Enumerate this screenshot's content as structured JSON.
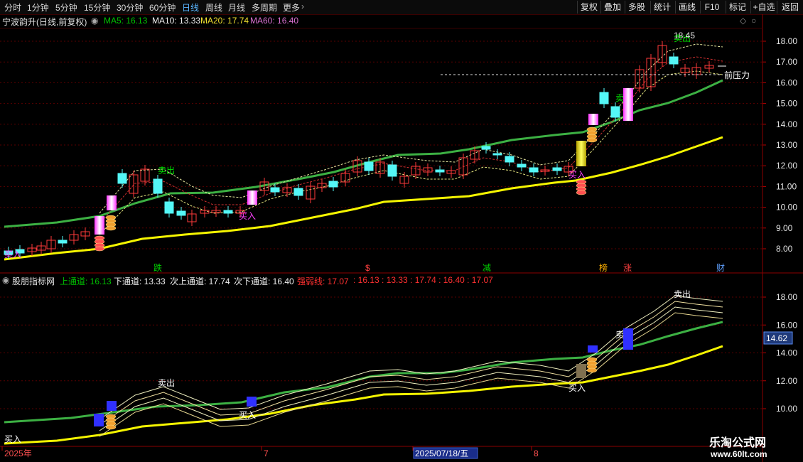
{
  "toolbar": {
    "periods": [
      "分时",
      "1分钟",
      "5分钟",
      "15分钟",
      "30分钟",
      "60分钟",
      "日线",
      "周线",
      "月线",
      "多周期",
      "更多"
    ],
    "active_period": "日线",
    "right_buttons": [
      "复权",
      "叠加",
      "多股",
      "统计",
      "画线",
      "F10",
      "标记",
      "+自选",
      "返回"
    ]
  },
  "main_panel": {
    "title": "宁波韵升(日线,前复权)",
    "ma": [
      {
        "label": "MA5: 16.13",
        "color": "#00c000"
      },
      {
        "label": "MA10: 13.33",
        "color": "#f0f0f0"
      },
      {
        "label": "MA20: 17.74",
        "color": "#f0e030"
      },
      {
        "label": "MA60: 16.40",
        "color": "#d870d0"
      }
    ],
    "y_ticks": [
      "18.00",
      "17.00",
      "16.00",
      "15.00",
      "14.00",
      "13.00",
      "12.00",
      "11.00",
      "10.00",
      "9.00",
      "8.00"
    ],
    "annotations": [
      {
        "id": "sell1",
        "text": "卖出"
      },
      {
        "id": "sell2",
        "text": "卖出"
      },
      {
        "id": "buy1",
        "text": "买入"
      },
      {
        "id": "buy2",
        "text": "买入"
      },
      {
        "id": "buy3",
        "text": "买入"
      },
      {
        "id": "peak",
        "text": "18.45"
      },
      {
        "id": "resist",
        "text": "前压力"
      },
      {
        "id": "m1",
        "text": "卖"
      }
    ],
    "event_marks": [
      {
        "text": "跌",
        "color": "#00d000"
      },
      {
        "text": "$",
        "color": "#ff4040"
      },
      {
        "text": "减",
        "color": "#00d000"
      },
      {
        "text": "榜",
        "color": "#ffb000"
      },
      {
        "text": "涨",
        "color": "#ff4040"
      },
      {
        "text": "财",
        "color": "#60a0ff"
      }
    ]
  },
  "sub_panel": {
    "title": "股朋指标网",
    "lines": [
      {
        "label": "上通道: 16.13",
        "color": "#00c000"
      },
      {
        "label": "下通道: 13.33",
        "color": "#f0f0f0"
      },
      {
        "label": "次上通道: 17.74",
        "color": "#f0f0f0"
      },
      {
        "label": "次下通道: 16.40",
        "color": "#f0f0f0"
      },
      {
        "label": "强弱线: 17.07",
        "color": "#ff3030"
      },
      {
        "label": ": 16.13 : 13.33 : 17.74 : 16.40 : 17.07",
        "color": "#ff3030"
      }
    ],
    "y_ticks": [
      "18.00",
      "16.00",
      "14.00",
      "12.00",
      "10.00"
    ],
    "current_price": "14.62",
    "annotations": [
      {
        "id": "s_buy1",
        "text": "买入"
      },
      {
        "id": "s_sell1",
        "text": "卖出"
      },
      {
        "id": "s_buy2",
        "text": "买入"
      },
      {
        "id": "s_buy3",
        "text": "买入"
      },
      {
        "id": "s_sell2",
        "text": "卖出"
      },
      {
        "id": "s_m1",
        "text": "卖"
      }
    ]
  },
  "time_axis": {
    "labels": [
      "2025年",
      "7",
      "2025/07/18/五",
      "8"
    ]
  },
  "watermark": {
    "title": "乐淘公式网",
    "url": "www.60lt.com"
  }
}
